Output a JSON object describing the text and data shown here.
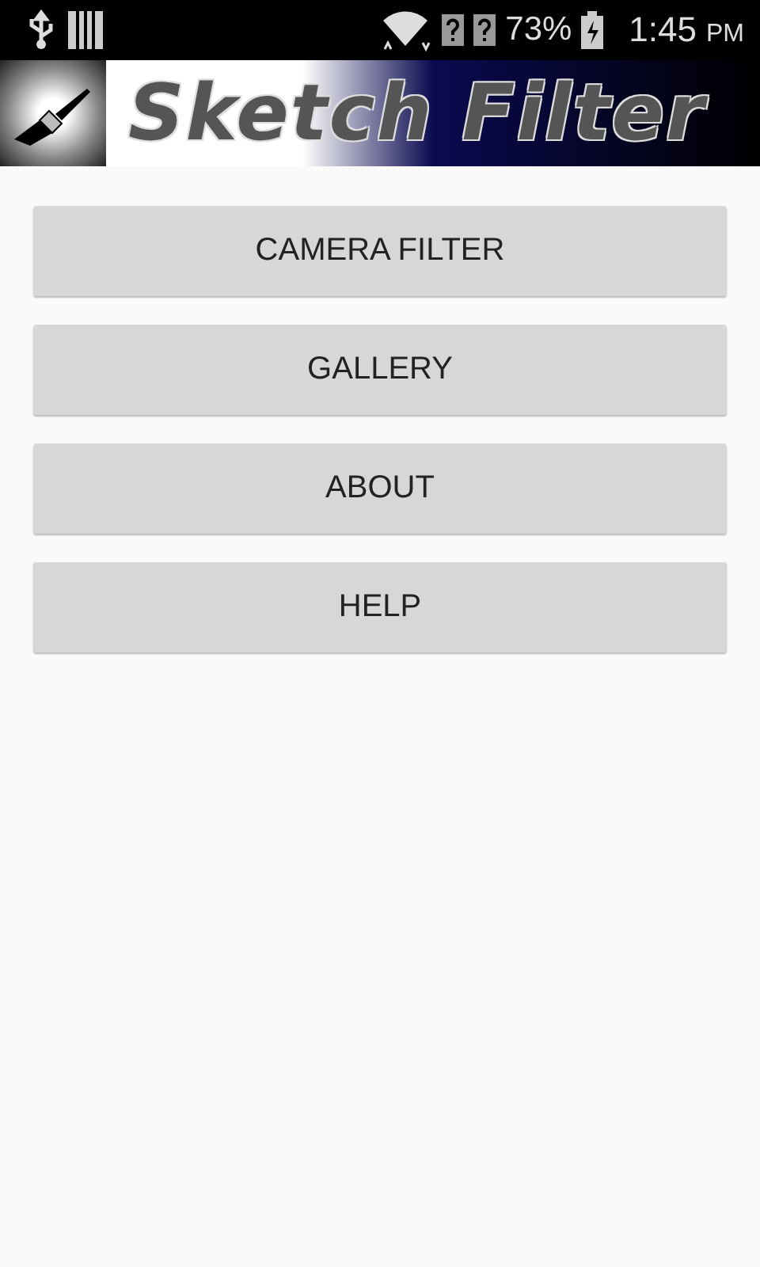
{
  "status_bar": {
    "battery": "73%",
    "time": "1:45",
    "period": "PM"
  },
  "banner": {
    "title": "Sketch Filter"
  },
  "buttons": [
    {
      "label": "CAMERA FILTER"
    },
    {
      "label": "GALLERY"
    },
    {
      "label": "ABOUT"
    },
    {
      "label": "HELP"
    }
  ]
}
